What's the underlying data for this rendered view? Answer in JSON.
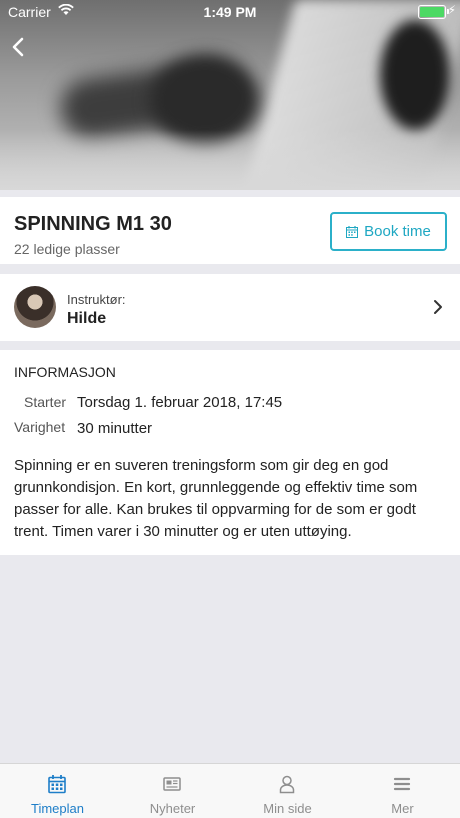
{
  "status_bar": {
    "carrier": "Carrier",
    "time": "1:49 PM"
  },
  "session": {
    "title": "SPINNING M1 30",
    "availability": "22 ledige plasser",
    "book_label": "Book time"
  },
  "instructor": {
    "label": "Instruktør:",
    "name": "Hilde"
  },
  "info": {
    "heading": "INFORMASJON",
    "start_label": "Starter",
    "start_value": "Torsdag 1. februar 2018, 17:45",
    "duration_label": "Varighet",
    "duration_value": "30 minutter",
    "description": "Spinning er en suveren treningsform som gir deg en god grunnkondisjon. En kort, grunnleggende og effektiv time som passer for alle. Kan brukes til oppvarming for de som er godt trent. Timen varer i 30 minutter og er uten uttøying."
  },
  "tabs": [
    {
      "label": "Timeplan",
      "icon": "calendar-icon",
      "active": true
    },
    {
      "label": "Nyheter",
      "icon": "newspaper-icon",
      "active": false
    },
    {
      "label": "Min side",
      "icon": "user-icon",
      "active": false
    },
    {
      "label": "Mer",
      "icon": "menu-icon",
      "active": false
    }
  ],
  "colors": {
    "accent": "#1ea7c2",
    "tab_active": "#1e7ec8",
    "battery": "#4cd964"
  }
}
